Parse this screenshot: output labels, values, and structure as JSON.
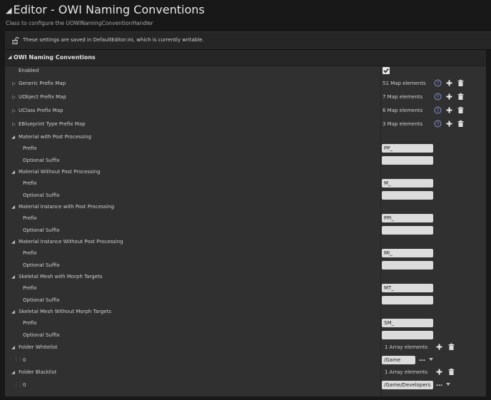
{
  "header": {
    "title": "Editor - OWI Naming Conventions",
    "subtitle": "Class to configure the UOWINamingConventionHandler",
    "notice": "These settings are saved in DefaultEditor.ini, which is currently writable."
  },
  "section": {
    "title": "OWI Naming Conventions",
    "enabled_label": "Enabled",
    "enabled_value": true
  },
  "maps": [
    {
      "label": "Generic Prefix Map",
      "value": "51 Map elements"
    },
    {
      "label": "UObject Prefix Map",
      "value": "7 Map elements"
    },
    {
      "label": "UClass Prefix Map",
      "value": "6 Map elements"
    },
    {
      "label": "EBlueprint Type Prefix Map",
      "value": "3 Map elements"
    }
  ],
  "groups": [
    {
      "label": "Material with Post Processing",
      "prefix_label": "Prefix",
      "prefix": "PP_",
      "suffix_label": "Optional Suffix",
      "suffix": ""
    },
    {
      "label": "Material Without Post Processing",
      "prefix_label": "Prefix",
      "prefix": "M_",
      "suffix_label": "Optional Suffix",
      "suffix": ""
    },
    {
      "label": "Material Instance with Post Processing",
      "prefix_label": "Prefix",
      "prefix": "PPI_",
      "suffix_label": "Optional Suffix",
      "suffix": ""
    },
    {
      "label": "Material Instance Without Post Processing",
      "prefix_label": "Prefix",
      "prefix": "MI_",
      "suffix_label": "Optional Suffix",
      "suffix": ""
    },
    {
      "label": "Skeletal Mesh with Morph Targets",
      "prefix_label": "Prefix",
      "prefix": "MT_",
      "suffix_label": "Optional Suffix",
      "suffix": ""
    },
    {
      "label": "Skeletal Mesh Without Morph Targets",
      "prefix_label": "Prefix",
      "prefix": "SM_",
      "suffix_label": "Optional Suffix",
      "suffix": ""
    }
  ],
  "lists": [
    {
      "label": "Folder Whitelist",
      "value": "1 Array elements",
      "item_index": "0",
      "item_value": "/Game"
    },
    {
      "label": "Folder Blacklist",
      "value": "1 Array elements",
      "item_index": "0",
      "item_value": "/Game/Developers"
    }
  ],
  "icons": {
    "help": "help-icon",
    "add": "add-icon",
    "delete": "trash-icon"
  },
  "colors": {
    "accent": "#a8a8a8",
    "background": "#303030",
    "header": "#262626"
  }
}
